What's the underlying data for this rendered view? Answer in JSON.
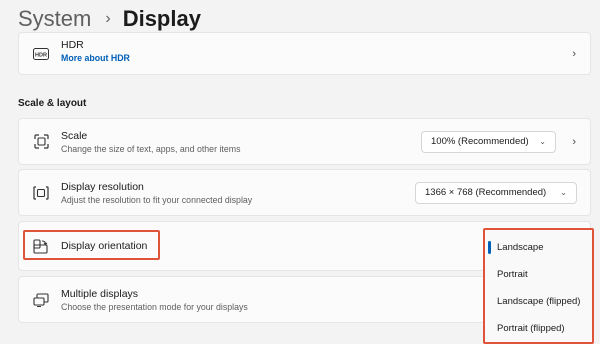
{
  "breadcrumb": {
    "parent": "System",
    "separator": "›",
    "current": "Display"
  },
  "hdr": {
    "title": "HDR",
    "link": "More about HDR",
    "icon": "hdr-icon"
  },
  "section": {
    "scale_layout": "Scale & layout"
  },
  "scale": {
    "title": "Scale",
    "subtitle": "Change the size of text, apps, and other items",
    "value": "100% (Recommended)",
    "icon": "scale-icon"
  },
  "resolution": {
    "title": "Display resolution",
    "subtitle": "Adjust the resolution to fit your connected display",
    "value": "1366 × 768 (Recommended)",
    "icon": "resolution-icon"
  },
  "orientation": {
    "title": "Display orientation",
    "icon": "orientation-icon",
    "options": [
      "Landscape",
      "Portrait",
      "Landscape (flipped)",
      "Portrait (flipped)"
    ],
    "selected": "Landscape"
  },
  "multiple": {
    "title": "Multiple displays",
    "subtitle": "Choose the presentation mode for your displays",
    "icon": "multiple-displays-icon"
  },
  "colors": {
    "accent": "#005fb8",
    "highlight": "#e0533b"
  }
}
